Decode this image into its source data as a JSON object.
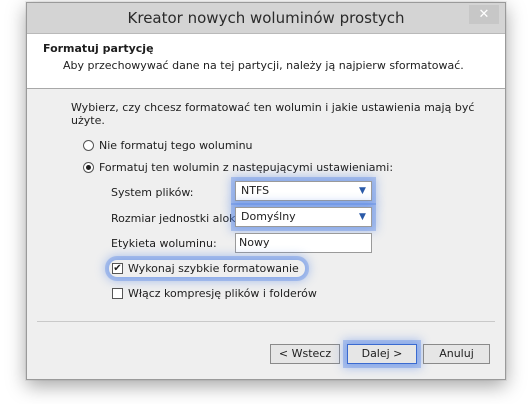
{
  "window": {
    "title": "Kreator nowych woluminów prostych",
    "close_glyph": "✕"
  },
  "header": {
    "title": "Formatuj partycję",
    "subtitle": "Aby przechowywać dane na tej partycji, należy ją najpierw sformatować."
  },
  "content": {
    "instruction": "Wybierz, czy chcesz formatować ten wolumin i jakie ustawienia mają być użyte.",
    "option_no_format": {
      "label": "Nie formatuj tego woluminu",
      "checked": false
    },
    "option_format": {
      "label": "Formatuj ten wolumin z następującymi ustawieniami:",
      "checked": true
    },
    "fields": {
      "filesystem": {
        "label": "System plików:",
        "value": "NTFS"
      },
      "allocation": {
        "label": "Rozmiar jednostki alokacji:",
        "value": "Domyślny"
      },
      "volume_label": {
        "label": "Etykieta woluminu:",
        "value": "Nowy"
      }
    },
    "quick_format": {
      "label": "Wykonaj szybkie formatowanie",
      "checked": true,
      "check_glyph": "✔"
    },
    "compression": {
      "label": "Włącz kompresję plików i folderów",
      "checked": false
    }
  },
  "buttons": {
    "back": "< Wstecz",
    "next": "Dalej >",
    "cancel": "Anuluj"
  },
  "icons": {
    "dropdown": "chevron-down-icon",
    "radio": "radio-button",
    "checkbox": "checkbox"
  },
  "colors": {
    "highlight_glow": "#5082e6",
    "dialog_bg": "#efefef",
    "header_bg": "#ffffff"
  }
}
